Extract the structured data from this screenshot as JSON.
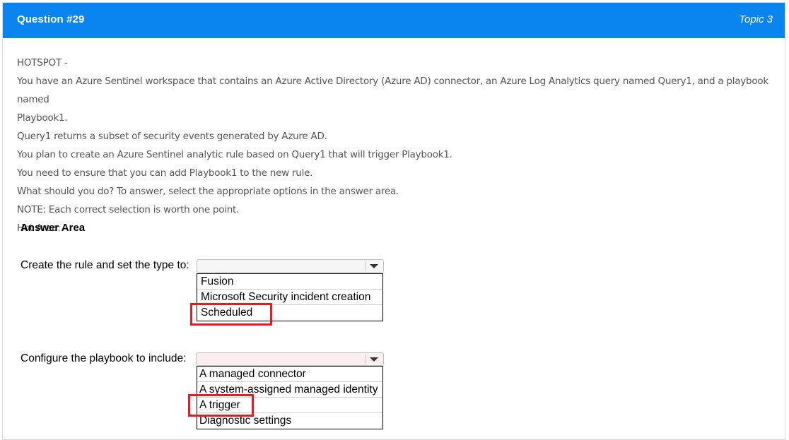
{
  "header": {
    "question": "Question #29",
    "topic": "Topic 3"
  },
  "question_lines": [
    "HOTSPOT -",
    "You have an Azure Sentinel workspace that contains an Azure Active Directory (Azure AD) connector, an Azure Log Analytics query named Query1, and a playbook named",
    "Playbook1.",
    "Query1 returns a subset of security events generated by Azure AD.",
    "You plan to create an Azure Sentinel analytic rule based on Query1 that will trigger Playbook1.",
    "You need to ensure that you can add Playbook1 to the new rule.",
    "What should you do? To answer, select the appropriate options in the answer area.",
    "NOTE: Each correct selection is worth one point.",
    "Hot Area:"
  ],
  "answer_area": {
    "title": "Answer Area",
    "rows": [
      {
        "label": "Create the rule and set the type to:",
        "options": [
          "Fusion",
          "Microsoft Security incident creation",
          "Scheduled"
        ],
        "highlighted": "Scheduled"
      },
      {
        "label": "Configure the playbook to include:",
        "options": [
          "A managed connector",
          "A system-assigned managed identity",
          "A trigger",
          "Diagnostic settings"
        ],
        "highlighted": "A trigger"
      }
    ]
  },
  "colors": {
    "header_bg": "#0a84ee",
    "highlight": "#e31b23"
  },
  "icons": [
    "dropdown-arrow-icon"
  ]
}
